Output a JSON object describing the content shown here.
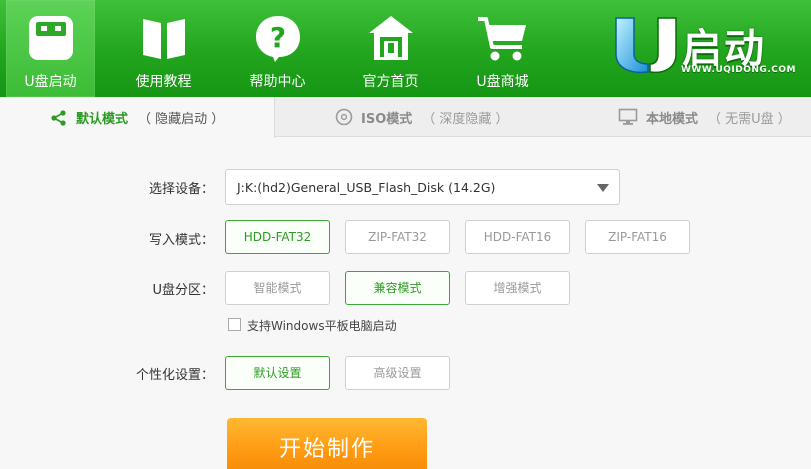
{
  "nav": {
    "items": [
      {
        "label": "U盘启动",
        "icon": "usb-drive-icon",
        "active": true
      },
      {
        "label": "使用教程",
        "icon": "book-icon",
        "active": false
      },
      {
        "label": "帮助中心",
        "icon": "help-icon",
        "active": false
      },
      {
        "label": "官方首页",
        "icon": "home-icon",
        "active": false
      },
      {
        "label": "U盘商城",
        "icon": "cart-icon",
        "active": false
      }
    ]
  },
  "brand": {
    "name": "启动",
    "logo_letter": "U",
    "url": "WWW.UQIDONG.COM"
  },
  "tabs": [
    {
      "title": "默认模式",
      "subtitle": "（ 隐藏启动 ）",
      "icon": "share-nodes-icon",
      "active": true
    },
    {
      "title": "ISO模式",
      "subtitle": "（ 深度隐藏 ）",
      "icon": "disc-icon",
      "active": false
    },
    {
      "title": "本地模式",
      "subtitle": "（ 无需U盘 ）",
      "icon": "monitor-icon",
      "active": false
    }
  ],
  "form": {
    "device_label": "选择设备：",
    "device_value": "J:K:(hd2)General_USB_Flash_Disk (14.2G)",
    "write_mode_label": "写入模式：",
    "write_modes": [
      "HDD-FAT32",
      "ZIP-FAT32",
      "HDD-FAT16",
      "ZIP-FAT16"
    ],
    "write_mode_selected": 0,
    "partition_label": "U盘分区：",
    "partitions": [
      "智能模式",
      "兼容模式",
      "增强模式"
    ],
    "partition_selected": 1,
    "tablet_checkbox_label": "支持Windows平板电脑启动",
    "tablet_checked": false,
    "personalize_label": "个性化设置：",
    "personalize_options": [
      "默认设置",
      "高级设置"
    ],
    "personalize_selected": 0,
    "start_button": "开始制作"
  },
  "colors": {
    "brand_green": "#22a51e",
    "accent_green": "#2c9b23",
    "start_orange": "#ff9a11"
  }
}
